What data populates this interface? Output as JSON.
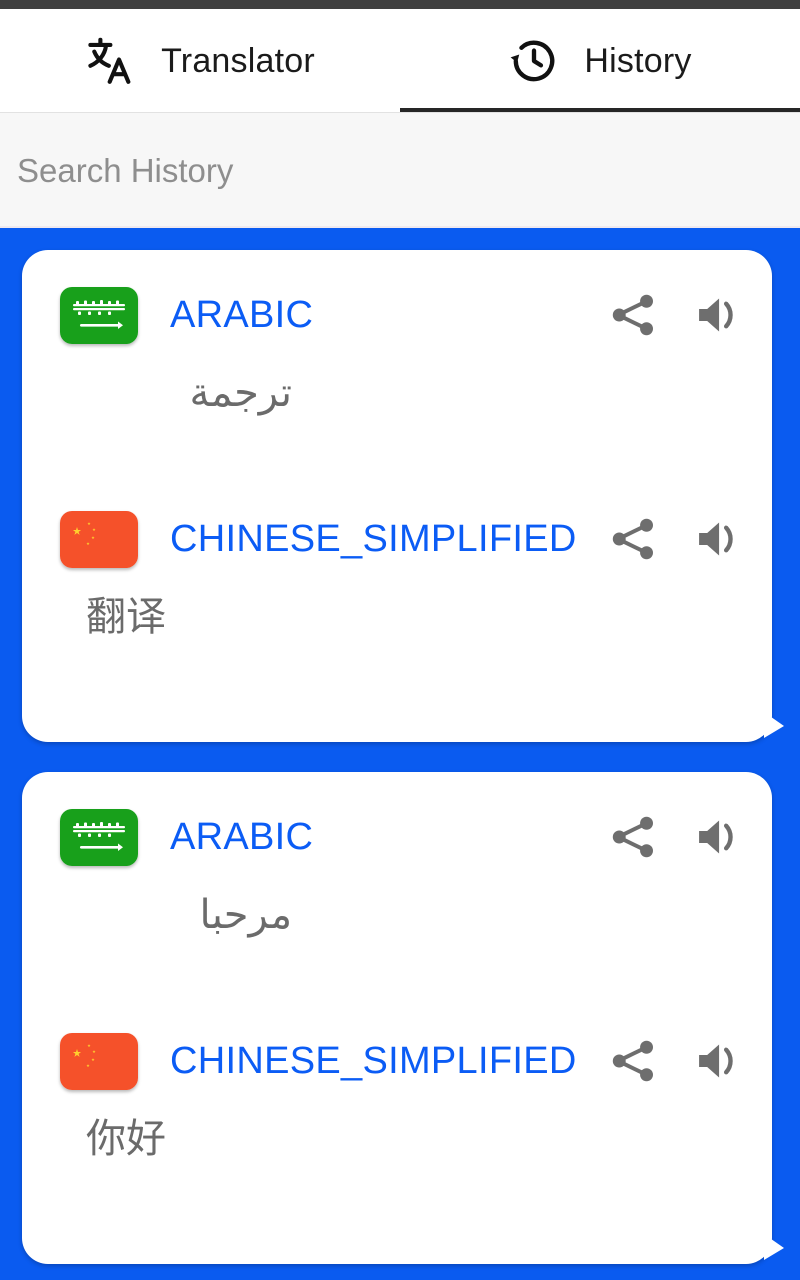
{
  "app": {
    "title": "Translator History"
  },
  "tabs": [
    {
      "id": "translator",
      "label": "Translator",
      "icon": "translate-icon",
      "active": false
    },
    {
      "id": "history",
      "label": "History",
      "icon": "history-clock-icon",
      "active": true
    }
  ],
  "search": {
    "placeholder": "Search History",
    "value": ""
  },
  "colors": {
    "accent_blue": "#0a5bf0",
    "language_blue": "#0b5cf5",
    "text_gray": "#6b6b6b",
    "placeholder_gray": "#8e8e8e",
    "tab_indicator": "#262626",
    "search_background": "#f7f7f7",
    "saudi_green": "#18a01b",
    "china_red": "#f5512a",
    "china_yellow": "#ffd02e",
    "icon_gray": "#6e6e6e"
  },
  "actions": {
    "share_label": "share-icon",
    "speak_label": "volume-icon"
  },
  "history": [
    {
      "id": "entry-1",
      "source": {
        "language": "ARABIC",
        "flag": "saudi-arabia-flag",
        "text": "ترجمة"
      },
      "target": {
        "language": "CHINESE_SIMPLIFIED",
        "flag": "china-flag",
        "text": "翻译"
      }
    },
    {
      "id": "entry-2",
      "source": {
        "language": "ARABIC",
        "flag": "saudi-arabia-flag",
        "text": "مرحبا"
      },
      "target": {
        "language": "CHINESE_SIMPLIFIED",
        "flag": "china-flag",
        "text": "你好"
      }
    }
  ]
}
